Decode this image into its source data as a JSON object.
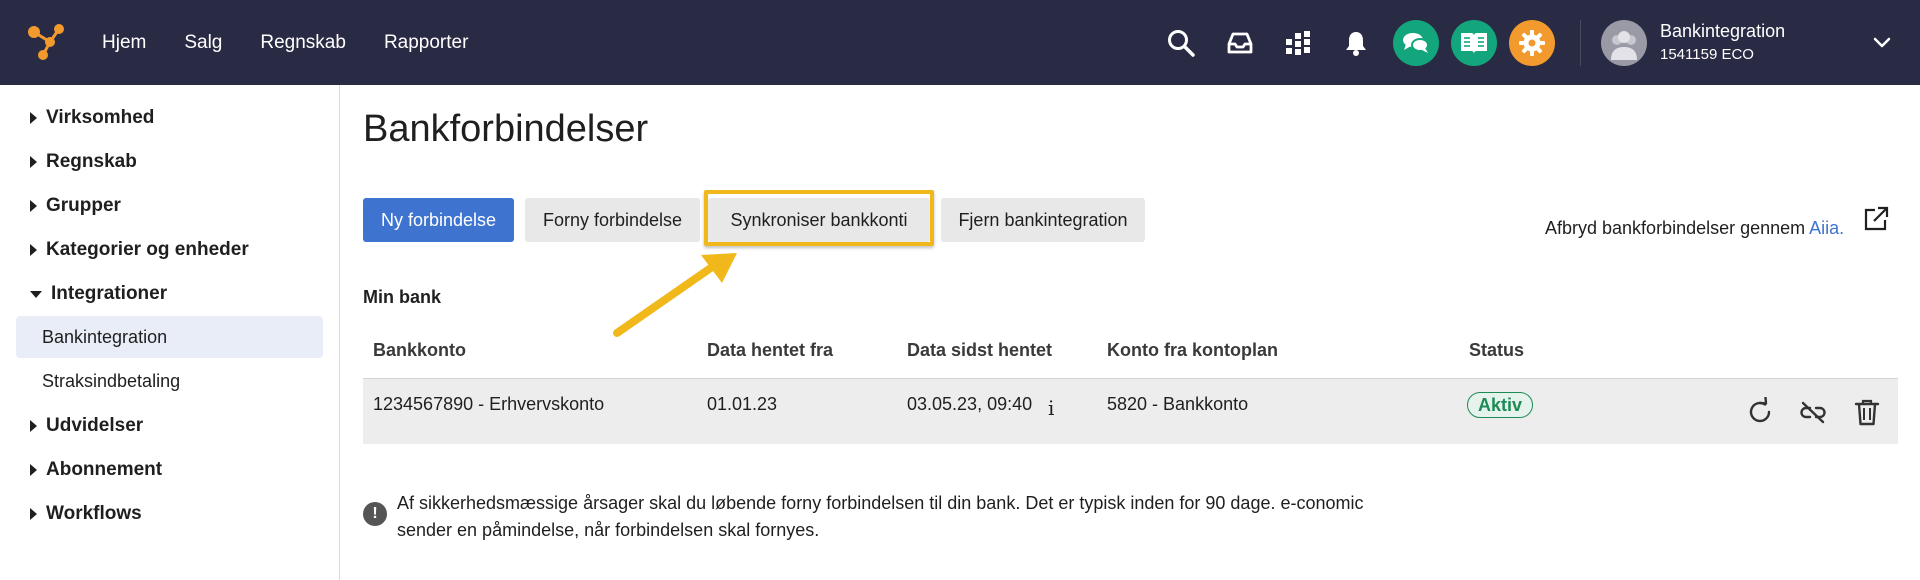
{
  "nav": {
    "items": [
      "Hjem",
      "Salg",
      "Regnskab",
      "Rapporter"
    ]
  },
  "user": {
    "name": "Bankintegration",
    "sub": "1541159 ECO"
  },
  "sidebar": {
    "items": [
      "Virksomhed",
      "Regnskab",
      "Grupper",
      "Kategorier og enheder",
      "Integrationer"
    ],
    "sub_items": [
      "Bankintegration",
      "Straksindbetaling"
    ],
    "items_after": [
      "Udvidelser",
      "Abonnement",
      "Workflows"
    ]
  },
  "page": {
    "title": "Bankforbindelser"
  },
  "buttons": {
    "new": "Ny forbindelse",
    "renew": "Forny forbindelse",
    "sync": "Synkroniser bankkonti",
    "remove": "Fjern bankintegration"
  },
  "aiia": {
    "text": "Afbryd bankforbindelser gennem ",
    "link": "Aiia."
  },
  "section": {
    "title": "Min bank"
  },
  "table": {
    "headers": [
      "Bankkonto",
      "Data hentet fra",
      "Data sidst hentet",
      "Konto fra kontoplan",
      "Status"
    ],
    "row": {
      "account": "1234567890 - Erhvervskonto",
      "from": "01.01.23",
      "last": "03.05.23, 09:40",
      "info": "i",
      "chart_account": "5820 - Bankkonto",
      "status": "Aktiv"
    }
  },
  "notice": {
    "text": "Af sikkerhedsmæssige årsager skal du løbende forny forbindelsen til din bank. Det er typisk inden for 90 dage. e-conomic sender en påmindelse, når forbindelsen skal fornyes."
  },
  "colors": {
    "topbar": "#292a43",
    "primary": "#3e73d0",
    "highlight": "#f1b81b",
    "active": "#1d8b56",
    "green_icon": "#13a67c",
    "orange_icon": "#f29a2e"
  }
}
